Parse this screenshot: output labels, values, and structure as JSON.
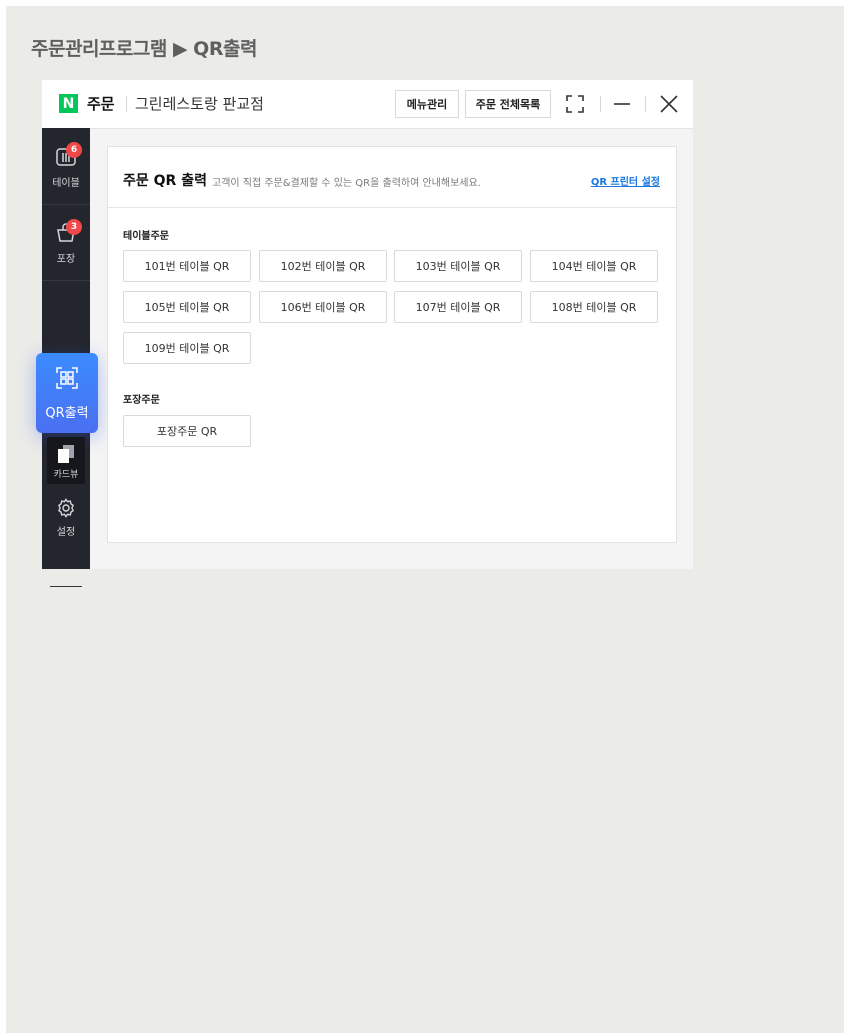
{
  "page": {
    "title": "주문관리프로그램 ▶ QR출력"
  },
  "titlebar": {
    "logo": "N",
    "app_name": "주문",
    "store_name": "그린레스토랑 판교점",
    "menu_manage_label": "메뉴관리",
    "all_orders_label": "주문 전체목록"
  },
  "sidebar": {
    "items": [
      {
        "label": "테이블",
        "badge": "6",
        "icon": "table-icon"
      },
      {
        "label": "포장",
        "badge": "3",
        "icon": "basket-icon"
      },
      {
        "label": "QR출력",
        "icon": "qr-icon"
      },
      {
        "label": "카드뷰",
        "icon": "cards-icon"
      },
      {
        "label": "설정",
        "icon": "gear-icon"
      }
    ]
  },
  "panel": {
    "title": "주문 QR 출력",
    "description": "고객이 직접 주문&결제할 수 있는 QR을 출력하여 안내해보세요.",
    "printer_link": "QR 프린터 설정",
    "table_section": {
      "label": "테이블주문",
      "buttons": [
        "101번 테이블 QR",
        "102번 테이블 QR",
        "103번 테이블 QR",
        "104번 테이블 QR",
        "105번 테이블 QR",
        "106번 테이블 QR",
        "107번 테이블 QR",
        "108번 테이블 QR",
        "109번 테이블 QR"
      ]
    },
    "takeout_section": {
      "label": "포장주문",
      "buttons": [
        "포장주문 QR"
      ]
    }
  },
  "colors": {
    "naver_green": "#03c75a",
    "sidebar_bg": "#24262d",
    "active_blue": "#3b8cff",
    "badge_red": "#f04848",
    "link_blue": "#1a78e0"
  }
}
